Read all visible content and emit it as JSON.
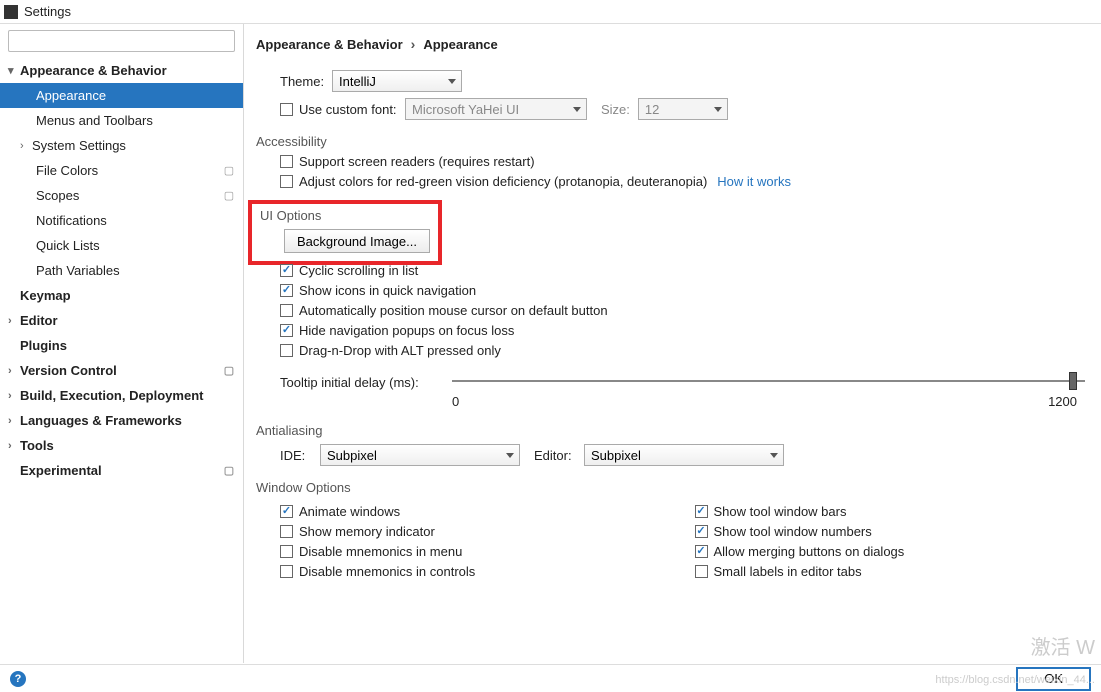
{
  "window": {
    "title": "Settings"
  },
  "search": {
    "placeholder": ""
  },
  "tree": {
    "appearance_behavior": "Appearance & Behavior",
    "appearance": "Appearance",
    "menus_toolbars": "Menus and Toolbars",
    "system_settings": "System Settings",
    "file_colors": "File Colors",
    "scopes": "Scopes",
    "notifications": "Notifications",
    "quick_lists": "Quick Lists",
    "path_variables": "Path Variables",
    "keymap": "Keymap",
    "editor": "Editor",
    "plugins": "Plugins",
    "version_control": "Version Control",
    "build": "Build, Execution, Deployment",
    "languages": "Languages & Frameworks",
    "tools": "Tools",
    "experimental": "Experimental"
  },
  "crumb": {
    "a": "Appearance & Behavior",
    "b": "Appearance"
  },
  "theme": {
    "label": "Theme:",
    "value": "IntelliJ"
  },
  "font": {
    "label": "Use custom font:",
    "value": "Microsoft YaHei UI",
    "size_label": "Size:",
    "size_value": "12"
  },
  "accessibility": {
    "title": "Accessibility",
    "screen_readers": "Support screen readers (requires restart)",
    "adjust_colors": "Adjust colors for red-green vision deficiency (protanopia, deuteranopia)",
    "how": "How it works"
  },
  "ui": {
    "title": "UI Options",
    "bg_image": "Background Image...",
    "cyclic": "Cyclic scrolling in list",
    "icons_nav": "Show icons in quick navigation",
    "auto_cursor": "Automatically position mouse cursor on default button",
    "hide_popups": "Hide navigation popups on focus loss",
    "dnd_alt": "Drag-n-Drop with ALT pressed only",
    "tooltip_label": "Tooltip initial delay (ms):",
    "tooltip_min": "0",
    "tooltip_max": "1200"
  },
  "aa": {
    "title": "Antialiasing",
    "ide_label": "IDE:",
    "ide_value": "Subpixel",
    "editor_label": "Editor:",
    "editor_value": "Subpixel"
  },
  "wo": {
    "title": "Window Options",
    "animate": "Animate windows",
    "memory": "Show memory indicator",
    "disable_menu": "Disable mnemonics in menu",
    "disable_ctrl": "Disable mnemonics in controls",
    "tool_bars": "Show tool window bars",
    "tool_numbers": "Show tool window numbers",
    "merge_btns": "Allow merging buttons on dialogs",
    "small_labels": "Small labels in editor tabs"
  },
  "footer": {
    "ok": "OK"
  },
  "watermark": {
    "a": "激活 W",
    "b": "https://blog.csdn.net/weixin_44..."
  }
}
